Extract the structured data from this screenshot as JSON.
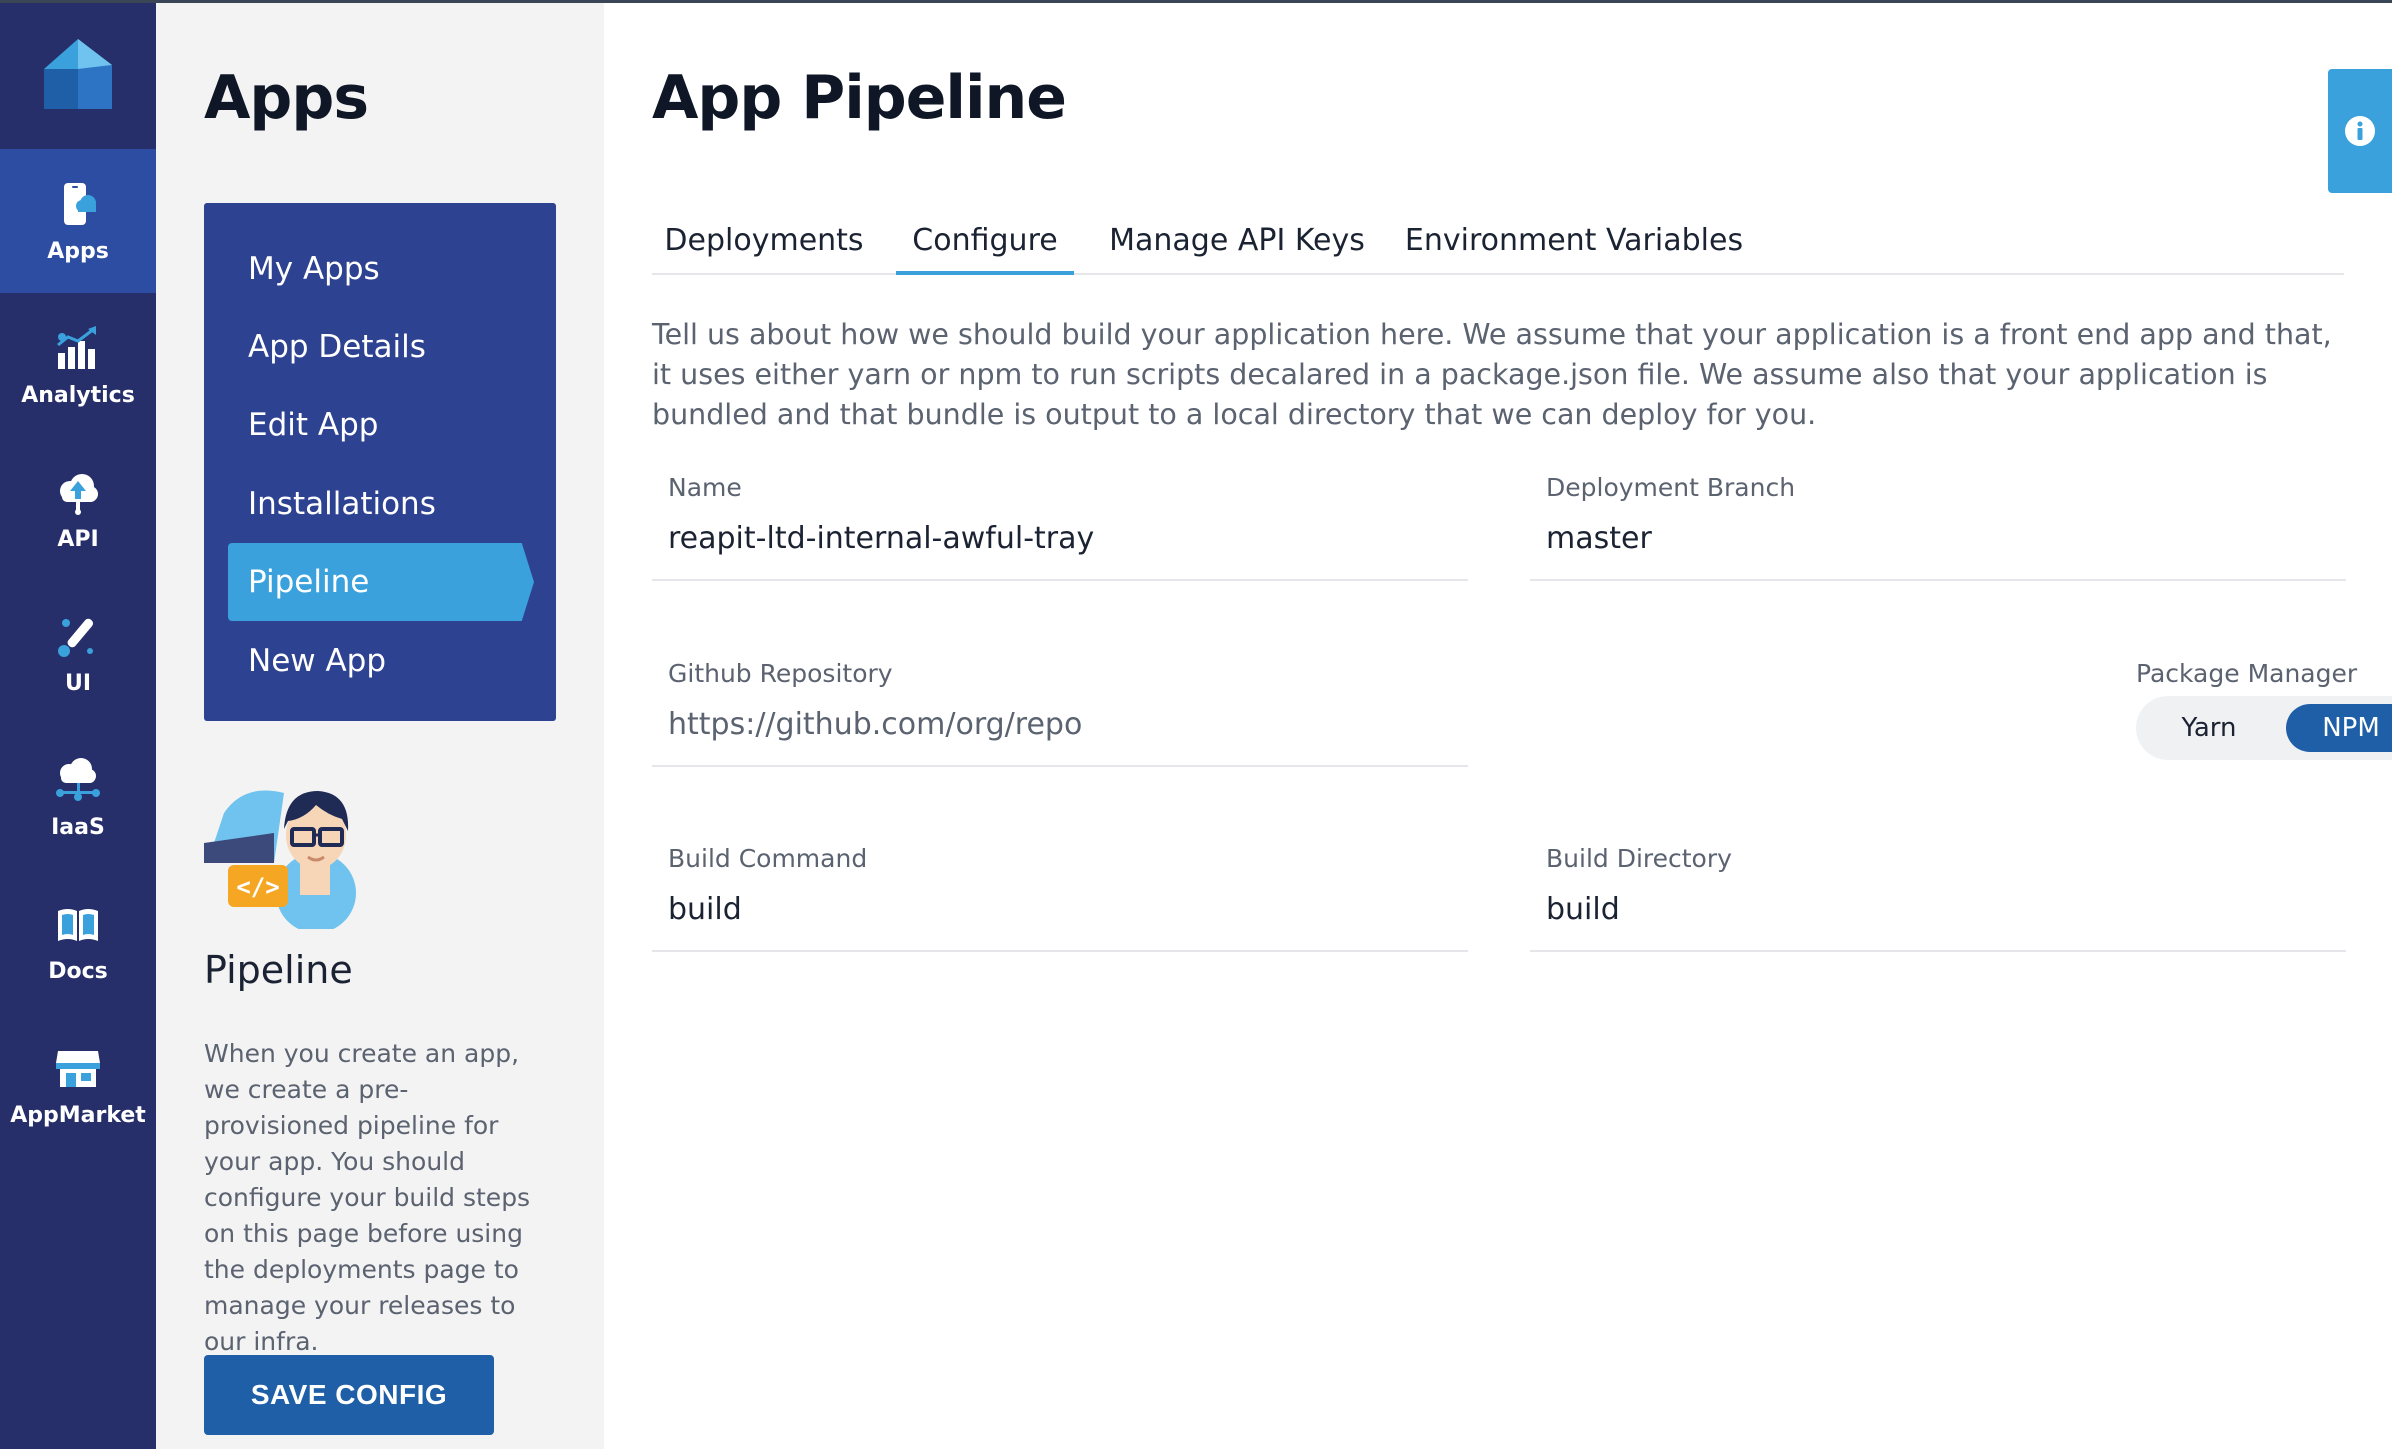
{
  "rail": {
    "items": [
      {
        "label": "Apps",
        "icon": "phone-cloud-icon",
        "active": true
      },
      {
        "label": "Analytics",
        "icon": "chart-icon",
        "active": false
      },
      {
        "label": "API",
        "icon": "cloud-upload-icon",
        "active": false
      },
      {
        "label": "UI",
        "icon": "paintbrush-icon",
        "active": false
      },
      {
        "label": "IaaS",
        "icon": "cloud-network-icon",
        "active": false
      },
      {
        "label": "Docs",
        "icon": "book-icon",
        "active": false
      },
      {
        "label": "AppMarket",
        "icon": "storefront-icon",
        "active": false
      }
    ]
  },
  "sidebar": {
    "title": "Apps",
    "menu": [
      {
        "label": "My Apps"
      },
      {
        "label": "App Details"
      },
      {
        "label": "Edit App"
      },
      {
        "label": "Installations"
      },
      {
        "label": "Pipeline",
        "active": true
      },
      {
        "label": "New App"
      }
    ],
    "heading": "Pipeline",
    "description": "When you create an app, we create a pre-provisioned pipeline for your app. You should configure your build steps on this page before using the deployments page to manage your releases to our infra.",
    "save_label": "SAVE CONFIG"
  },
  "main": {
    "title": "App Pipeline",
    "tabs": [
      {
        "label": "Deployments"
      },
      {
        "label": "Configure",
        "active": true
      },
      {
        "label": "Manage API Keys"
      },
      {
        "label": "Environment Variables"
      }
    ],
    "intro": "Tell us about how we should build your application here. We assume that your application is a front end app and that, it uses either yarn or npm to run scripts decalared in a package.json file. We assume also that your application is bundled and that bundle is output to a local directory that we can deploy for you.",
    "fields": {
      "name": {
        "label": "Name",
        "value": "reapit-ltd-internal-awful-tray"
      },
      "branch": {
        "label": "Deployment Branch",
        "value": "master"
      },
      "repo": {
        "label": "Github Repository",
        "placeholder": "https://github.com/org/repo"
      },
      "build_command": {
        "label": "Build Command",
        "value": "build"
      },
      "build_directory": {
        "label": "Build Directory",
        "value": "build"
      }
    },
    "package_manager": {
      "label": "Package Manager",
      "options": [
        "Yarn",
        "NPM"
      ],
      "selected": "NPM"
    }
  },
  "colors": {
    "rail_bg": "#262f69",
    "rail_active": "#2d4da2",
    "submenu_bg": "#2d4291",
    "accent": "#3aa1dc",
    "primary_button": "#1f5fa7"
  }
}
